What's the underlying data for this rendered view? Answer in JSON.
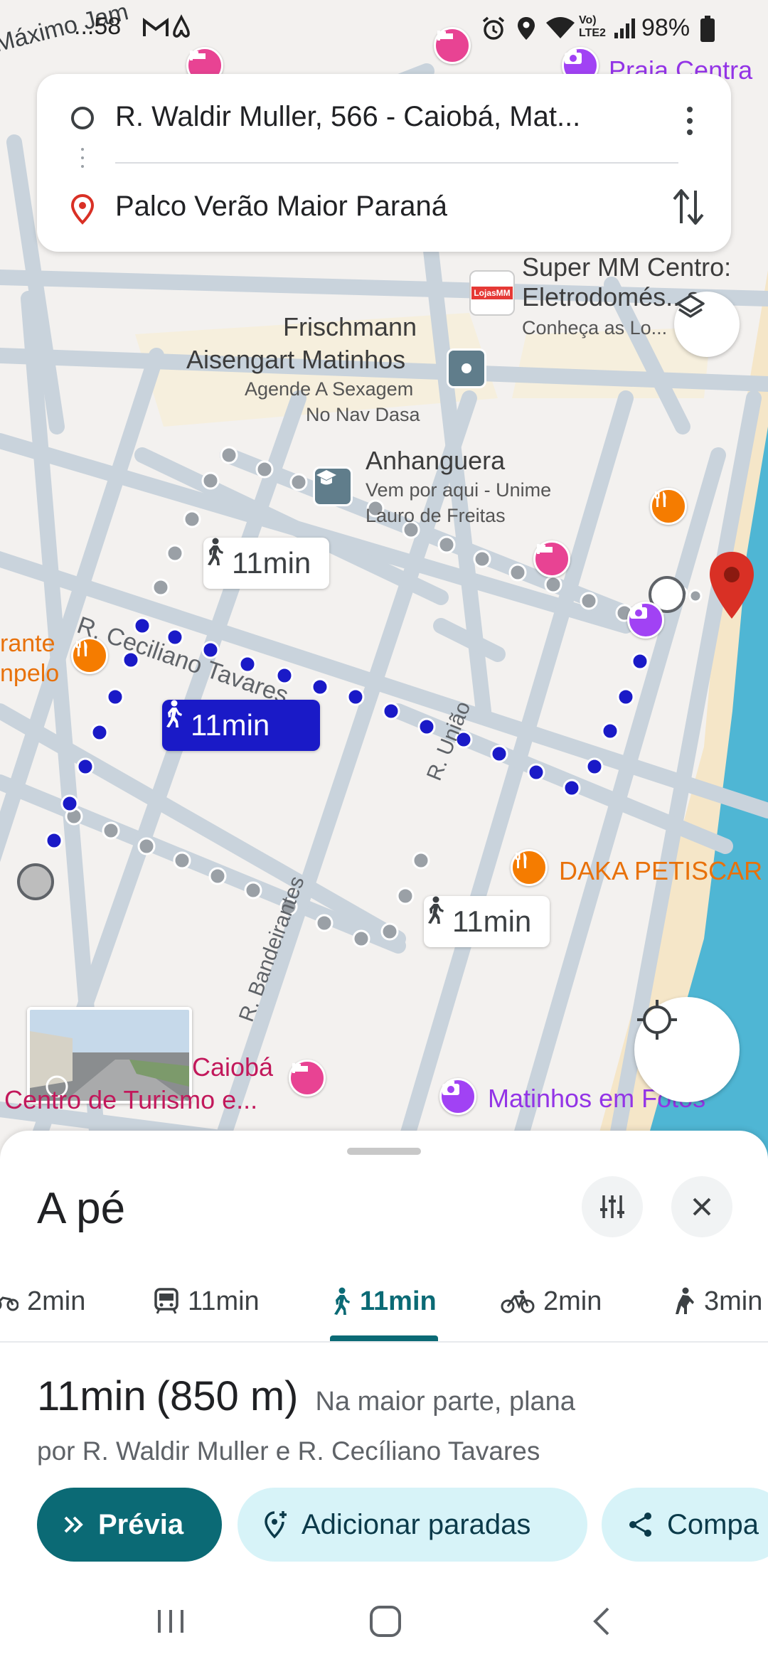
{
  "status_bar": {
    "time": "...58",
    "battery": "98%",
    "network": "Vo) LTE2"
  },
  "route": {
    "origin": "R. Waldir Muller, 566 - Caiobá, Mat...",
    "destination": "Palco Verão Maior Paraná"
  },
  "map": {
    "top_street": "Máximo Jam",
    "poi_top_right": "Praia Centra",
    "super_mm": {
      "line1": "Super MM Centro:",
      "line2": "Eletrodomés...s,...",
      "line3": "Conheça as Lo...",
      "logo": "LojasMM"
    },
    "frischmann": {
      "line1": "Frischmann",
      "line2": "Aisengart Matinhos",
      "line3": "Agende A Sexagem",
      "line4": "No Nav Dasa"
    },
    "anhanguera": {
      "line1": "Anhanguera",
      "line2": "Vem por aqui - Unime",
      "line3": "Lauro de Freitas"
    },
    "restaurante": {
      "line1": "rante",
      "line2": "npelo"
    },
    "streets": {
      "ceciliano": "R. Ceciliano Tavares",
      "uniao": "R. União",
      "bandeirantes": "R. Bandeirantes"
    },
    "daka": "DAKA PETISCAR",
    "caioba": "Caiobá",
    "centro_turismo": "Centro de Turismo e...",
    "matinhos_fotos": "Matinhos em Fotos",
    "bubbles": {
      "alt1": "11min",
      "selected": "11min",
      "alt2": "11min"
    }
  },
  "sheet": {
    "title": "A pé",
    "tabs": [
      {
        "label": "2min",
        "icon": "motorcycle-icon"
      },
      {
        "label": "11min",
        "icon": "transit-icon"
      },
      {
        "label": "11min",
        "icon": "walk-icon",
        "selected": true
      },
      {
        "label": "2min",
        "icon": "bike-icon"
      },
      {
        "label": "3min",
        "icon": "ride-icon"
      }
    ],
    "summary_time": "11min",
    "summary_distance": "(850 m)",
    "summary_terrain": "Na maior parte, plana",
    "via": "por R. Waldir Muller e R. Cecíliano Tavares",
    "chips": {
      "preview": "Prévia",
      "add_stops": "Adicionar paradas",
      "share": "Compa"
    }
  },
  "colors": {
    "accent": "#0b6a75",
    "route_blue": "#1a1ac7",
    "chip_bg": "#d7f3f8",
    "water": "#4fb6d4",
    "sand": "#f5e6c8",
    "pin_red": "#d93025"
  }
}
